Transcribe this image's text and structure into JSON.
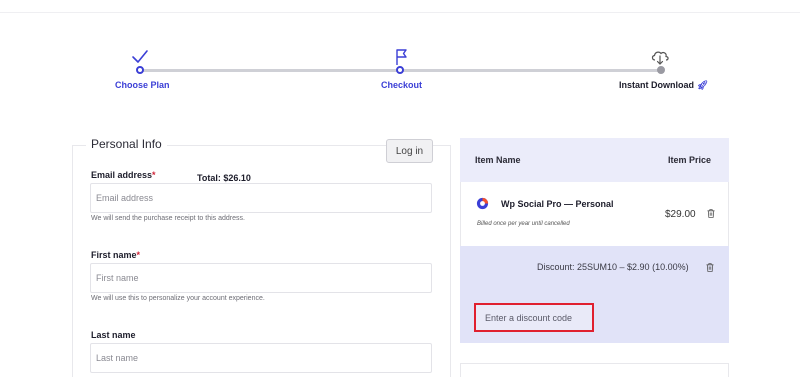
{
  "stepper": {
    "steps": [
      {
        "label": "Choose Plan",
        "icon": "checkmark-icon",
        "state": "complete"
      },
      {
        "label": "Checkout",
        "icon": "flag-icon",
        "state": "current"
      },
      {
        "label": "Instant Download",
        "icon": "cloud-download-icon",
        "state": "upcoming",
        "suffix_icon": "rocket-icon"
      }
    ]
  },
  "personal_info": {
    "title": "Personal Info",
    "login_label": "Log in",
    "fields": [
      {
        "label": "Email address",
        "required": "*",
        "placeholder": "Email address",
        "help": "We will send the purchase receipt to this address."
      },
      {
        "label": "First name",
        "required": "*",
        "placeholder": "First name",
        "help": "We will use this to personalize your account experience."
      },
      {
        "label": "Last name",
        "placeholder": "Last name"
      }
    ]
  },
  "summary": {
    "col_item": "Item Name",
    "col_price": "Item Price",
    "item": {
      "name": "Wp Social Pro — Personal",
      "billing": "Billed once per year until cancelled",
      "price": "$29.00"
    },
    "discount_text": "Discount:  25SUM10 – $2.90 (10.00%)",
    "discount_placeholder": "Enter a discount code",
    "total": "Total: $26.10"
  },
  "colors": {
    "accent": "#3b3fd6",
    "summary_header": "#ebecfa",
    "summary_footer": "#e1e3f8",
    "highlight_border": "#e0202f",
    "required": "#d0263a"
  }
}
